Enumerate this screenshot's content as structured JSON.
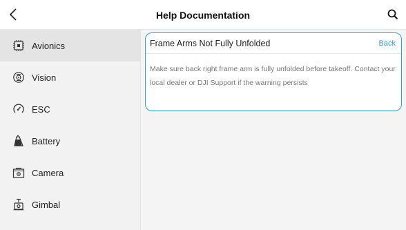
{
  "header": {
    "title": "Help Documentation",
    "back_icon": "chevron-left-icon",
    "search_icon": "search-icon"
  },
  "sidebar": {
    "items": [
      {
        "label": "Avionics",
        "icon": "avionics-chip-icon",
        "active": true
      },
      {
        "label": "Vision",
        "icon": "vision-sensor-icon",
        "active": false
      },
      {
        "label": "ESC",
        "icon": "esc-gauge-icon",
        "active": false
      },
      {
        "label": "Battery",
        "icon": "battery-icon",
        "active": false
      },
      {
        "label": "Camera",
        "icon": "camera-icon",
        "active": false
      },
      {
        "label": "Gimbal",
        "icon": "gimbal-icon",
        "active": false
      }
    ]
  },
  "article": {
    "title": "Frame Arms Not Fully Unfolded",
    "back_label": "Back",
    "body": "Make sure back right frame arm is fully unfolded before takeoff. Contact your local dealer or DJI Support if the warning persists"
  },
  "colors": {
    "accent": "#2a9fd8",
    "sidebar_bg": "#f2f2f2",
    "active_bg": "#e4e4e4",
    "body_text": "#777777"
  }
}
